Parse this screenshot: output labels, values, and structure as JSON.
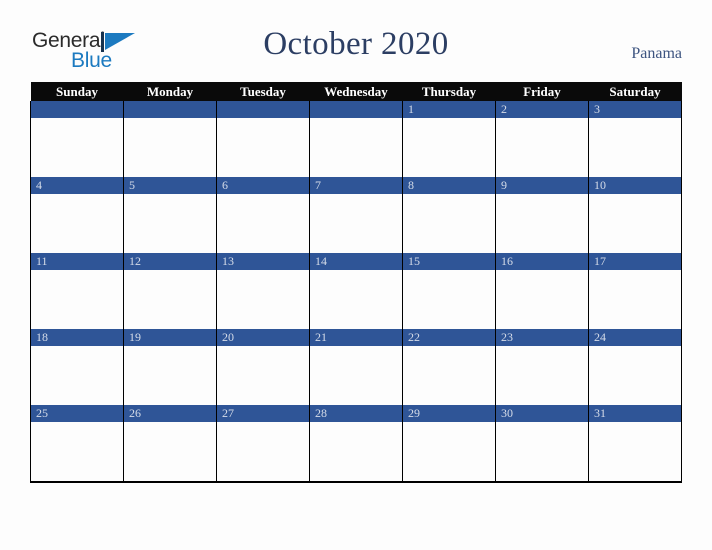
{
  "brand": {
    "name_top": "General",
    "name_bottom": "Blue",
    "mark": "triangle-logo-icon",
    "color_dark": "#2b2b2b",
    "color_blue": "#1c7ac0"
  },
  "header": {
    "title": "October 2020",
    "region": "Panama",
    "title_color": "#2c3e63",
    "region_color": "#3d5480"
  },
  "calendar": {
    "month": "October",
    "year": "2020",
    "header_bg": "#0a0a0a",
    "day_bar_color": "#2f5597",
    "day_number_color": "#d5dce8",
    "weekday_headers": [
      "Sunday",
      "Monday",
      "Tuesday",
      "Wednesday",
      "Thursday",
      "Friday",
      "Saturday"
    ],
    "weeks": [
      [
        "",
        "",
        "",
        "",
        "1",
        "2",
        "3"
      ],
      [
        "4",
        "5",
        "6",
        "7",
        "8",
        "9",
        "10"
      ],
      [
        "11",
        "12",
        "13",
        "14",
        "15",
        "16",
        "17"
      ],
      [
        "18",
        "19",
        "20",
        "21",
        "22",
        "23",
        "24"
      ],
      [
        "25",
        "26",
        "27",
        "28",
        "29",
        "30",
        "31"
      ]
    ]
  }
}
